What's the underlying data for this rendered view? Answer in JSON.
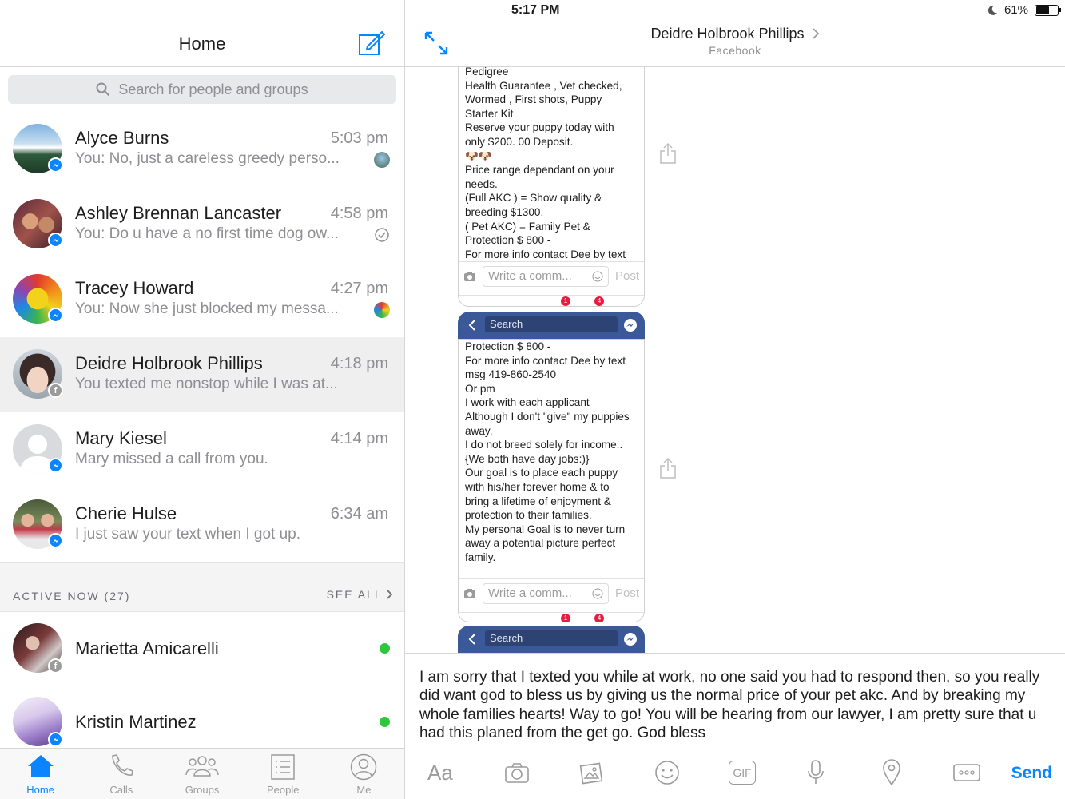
{
  "status_bar": {
    "time": "5:17 PM",
    "battery": "61%",
    "battery_level": 0.61
  },
  "home": {
    "title": "Home",
    "search_placeholder": "Search for people and groups"
  },
  "conversations": [
    {
      "name": "Alyce Burns",
      "time": "5:03 pm",
      "preview": "You: No, just a careless greedy perso...",
      "badge": "messenger",
      "selected": false
    },
    {
      "name": "Ashley Brennan Lancaster",
      "time": "4:58 pm",
      "preview": "You: Do u have a no first time dog ow...",
      "badge": "messenger",
      "selected": false
    },
    {
      "name": "Tracey Howard",
      "time": "4:27 pm",
      "preview": "You: Now she just blocked my messa...",
      "badge": "messenger",
      "selected": false
    },
    {
      "name": "Deidre Holbrook Phillips",
      "time": "4:18 pm",
      "preview": "You texted me nonstop while I was at...",
      "badge": "facebook",
      "selected": true
    },
    {
      "name": "Mary Kiesel",
      "time": "4:14 pm",
      "preview": "Mary missed a call from you.",
      "badge": "messenger",
      "selected": false
    },
    {
      "name": "Cherie Hulse",
      "time": "6:34 am",
      "preview": "I just saw your text when I got up.",
      "badge": "messenger",
      "selected": false
    }
  ],
  "active_now": {
    "label": "ACTIVE NOW (27)",
    "see_all": "SEE ALL",
    "people": [
      {
        "name": "Marietta Amicarelli",
        "badge": "facebook"
      },
      {
        "name": "Kristin Martinez",
        "badge": "messenger"
      }
    ]
  },
  "tabs": [
    {
      "label": "Home",
      "icon": "home-icon",
      "active": true
    },
    {
      "label": "Calls",
      "icon": "phone-icon",
      "active": false
    },
    {
      "label": "Groups",
      "icon": "groups-icon",
      "active": false
    },
    {
      "label": "People",
      "icon": "people-list-icon",
      "active": false
    },
    {
      "label": "Me",
      "icon": "profile-icon",
      "active": false
    }
  ],
  "chat": {
    "contact_name": "Deidre Holbrook Phillips",
    "contact_source": "Facebook",
    "screenshot1_text": "Pedigree\nHealth Guarantee ,  Vet checked,\nWormed , First shots, Puppy\nStarter Kit\nReserve your puppy today with\nonly $200. 00 Deposit.\n🐶🐶\nPrice range dependant on your\nneeds.\n(Full AKC ) = Show quality &\nbreeding  $1300.\n( Pet AKC)  = Family Pet &\nProtection $ 800 -\nFor more info contact Dee by text",
    "screenshot2_text": "Protection $ 800 -\nFor more info contact Dee by text\nmsg 419-860-2540\nOr pm\nI work with each applicant\nAlthough I don't \"give\" my puppies\naway,\nI do not breed solely for income..\n{We both have day jobs:)}\nOur goal is to place each puppy\nwith his/her forever home & to\nbring a lifetime of enjoyment &\nprotection to their families.\n My personal Goal is to never turn\naway a potential picture perfect\nfamily.",
    "comment_placeholder": "Write a comm...",
    "post_label": "Post",
    "fb_search": "Search",
    "badge_a": "1",
    "badge_b": "4",
    "compose_text": "I am sorry that I texted you while at work, no one said you had to respond then, so you really did want god to bless us by giving us the normal price of your pet akc. And by breaking my whole families hearts! Way to go! You will be hearing from our lawyer, I am pretty sure that u had this planed from the get go. God bless",
    "font_button": "Aa",
    "gif_label": "GIF",
    "send_label": "Send"
  },
  "colors": {
    "accent": "#0a84ff",
    "facebook_blue": "#3b5998",
    "online": "#2bc83c"
  }
}
